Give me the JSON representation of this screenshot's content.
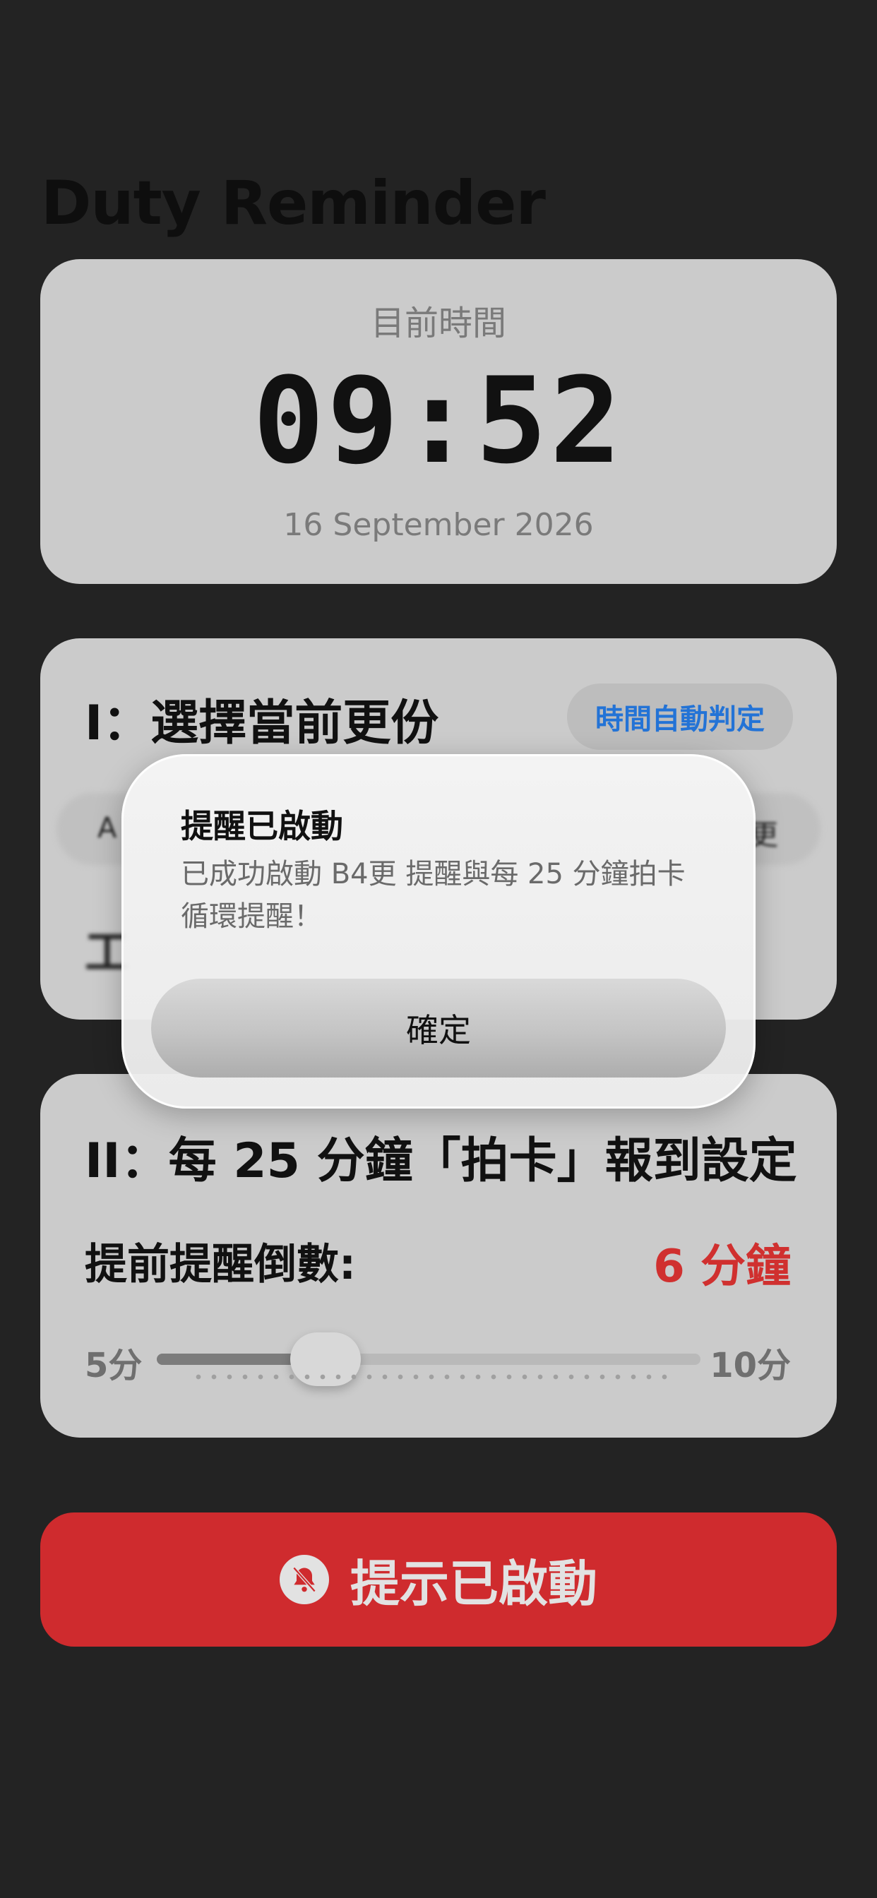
{
  "app": {
    "title": "Duty Reminder"
  },
  "clock": {
    "label": "目前時間",
    "time": "09:52",
    "date": "16 September 2026"
  },
  "shift_section": {
    "title": "I：選擇當前更份",
    "auto_detect_label": "時間自動判定",
    "segments_visible": [
      "A",
      "更"
    ],
    "work_time_label": "工"
  },
  "checkin_section": {
    "title": "II：每 25 分鐘「拍卡」報到設定",
    "lead_label": "提前提醒倒數:",
    "lead_value": "6 分鐘",
    "slider": {
      "min_label": "5分",
      "max_label": "10分",
      "min": 5,
      "max": 10,
      "value": 6
    }
  },
  "start_button": {
    "label": "提示已啟動",
    "icon": "bell-slash-icon"
  },
  "alert": {
    "title": "提醒已啟動",
    "message": "已成功啟動 B4更 提醒與每 25 分鐘拍卡循環提醒！",
    "confirm_label": "確定"
  },
  "colors": {
    "background": "#232323",
    "card": "#cbcbcb",
    "accent_red": "#cf2b2e",
    "value_red": "#d0302f",
    "link_blue": "#2373d6"
  }
}
